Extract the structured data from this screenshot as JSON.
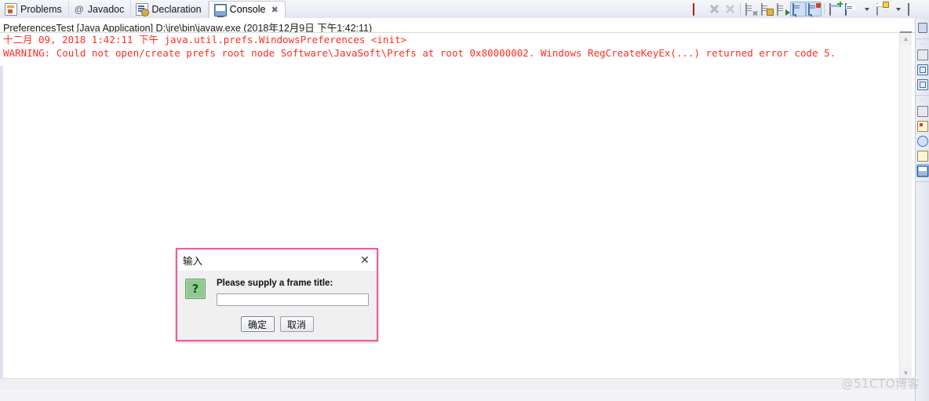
{
  "window": {
    "active_view": "Console"
  },
  "tabs": [
    {
      "label": "Problems",
      "icon": "problems-icon",
      "active": false
    },
    {
      "label": "Javadoc",
      "icon": "javadoc-icon",
      "active": false
    },
    {
      "label": "Declaration",
      "icon": "declaration-icon",
      "active": false
    },
    {
      "label": "Console",
      "icon": "console-icon",
      "active": true,
      "close": "✖"
    }
  ],
  "toolbar": {
    "items": [
      {
        "name": "terminate-button",
        "icon": "stop-icon",
        "tooltip": "Terminate"
      },
      {
        "name": "remove-launch-button",
        "icon": "remove-x-icon",
        "tooltip": "Remove Launch"
      },
      {
        "name": "remove-all-terminated-button",
        "icon": "remove-all-x-icon",
        "tooltip": "Remove All Terminated Launches"
      },
      {
        "name": "clear-console-button",
        "icon": "clear-console-icon",
        "tooltip": "Clear Console"
      },
      {
        "name": "scroll-lock-button",
        "icon": "scroll-lock-icon",
        "tooltip": "Scroll Lock"
      },
      {
        "name": "word-wrap-button",
        "icon": "word-wrap-icon",
        "tooltip": "Word Wrap"
      },
      {
        "name": "show-console-on-output-button",
        "icon": "pin-console-icon",
        "tooltip": "Show Console When Standard Out Changes"
      },
      {
        "name": "show-console-on-error-button",
        "icon": "pin-console-error-icon",
        "tooltip": "Show Console When Standard Error Changes"
      },
      {
        "name": "new-console-view-button",
        "icon": "new-console-icon",
        "tooltip": "Open Console"
      },
      {
        "name": "display-selected-console-button",
        "icon": "monitor-icon",
        "tooltip": "Display Selected Console"
      },
      {
        "name": "display-selected-console-menu",
        "icon": "chevron-down-icon",
        "tooltip": "Display Selected Console menu"
      },
      {
        "name": "open-console-button",
        "icon": "open-console-icon",
        "tooltip": "Open Console"
      },
      {
        "name": "open-console-menu",
        "icon": "chevron-down-icon",
        "tooltip": "Open Console menu"
      },
      {
        "name": "minimize-view-button",
        "icon": "restore-icon",
        "tooltip": "Minimize"
      }
    ],
    "chevron": "▼"
  },
  "console": {
    "launch_line": "PreferencesTest [Java Application] D:\\jre\\bin\\javaw.exe (2018年12月9日 下午1:42:11)",
    "lines": [
      "十二月 09, 2018 1:42:11 下午 java.util.prefs.WindowsPreferences <init>",
      "WARNING: Could not open/create prefs root node Software\\JavaSoft\\Prefs at root 0x80000002. Windows RegCreateKeyEx(...) returned error code 5."
    ],
    "text_color": "#ff2d21",
    "scrollbar": {
      "up_arrow": "▲",
      "down_arrow": "▼"
    }
  },
  "sidebar": {
    "groups": [
      {
        "dots": "··",
        "icons": [
          {
            "name": "restore-view-icon",
            "style": "spin"
          }
        ]
      },
      {
        "dots": "··",
        "icons": [
          {
            "name": "package-explorer-icon",
            "style": "blue"
          },
          {
            "name": "outline-view-icon",
            "style": "blue"
          },
          {
            "name": "type-hierarchy-icon",
            "style": "blue"
          }
        ]
      },
      {
        "dots": "··",
        "icons": [
          {
            "name": "problems-view-icon",
            "style": "blue"
          },
          {
            "name": "error-log-icon",
            "style": "red"
          },
          {
            "name": "javadoc-view-icon",
            "style": "glob"
          },
          {
            "name": "declaration-view-icon",
            "style": "pal"
          },
          {
            "name": "console-view-icon",
            "style": "mon",
            "selected": true
          }
        ]
      }
    ]
  },
  "dialog": {
    "title": "输入",
    "close_label": "✕",
    "icon": "question-icon",
    "icon_glyph": "?",
    "icon_color": "#8fc98f",
    "message": "Please supply a frame title:",
    "input_value": "",
    "input_placeholder": "",
    "buttons": [
      {
        "label": "确定",
        "name": "ok-button",
        "default": true
      },
      {
        "label": "取消",
        "name": "cancel-button",
        "default": false
      }
    ],
    "border_color": "#ef5a9e"
  },
  "watermark": "@51CTO博客"
}
